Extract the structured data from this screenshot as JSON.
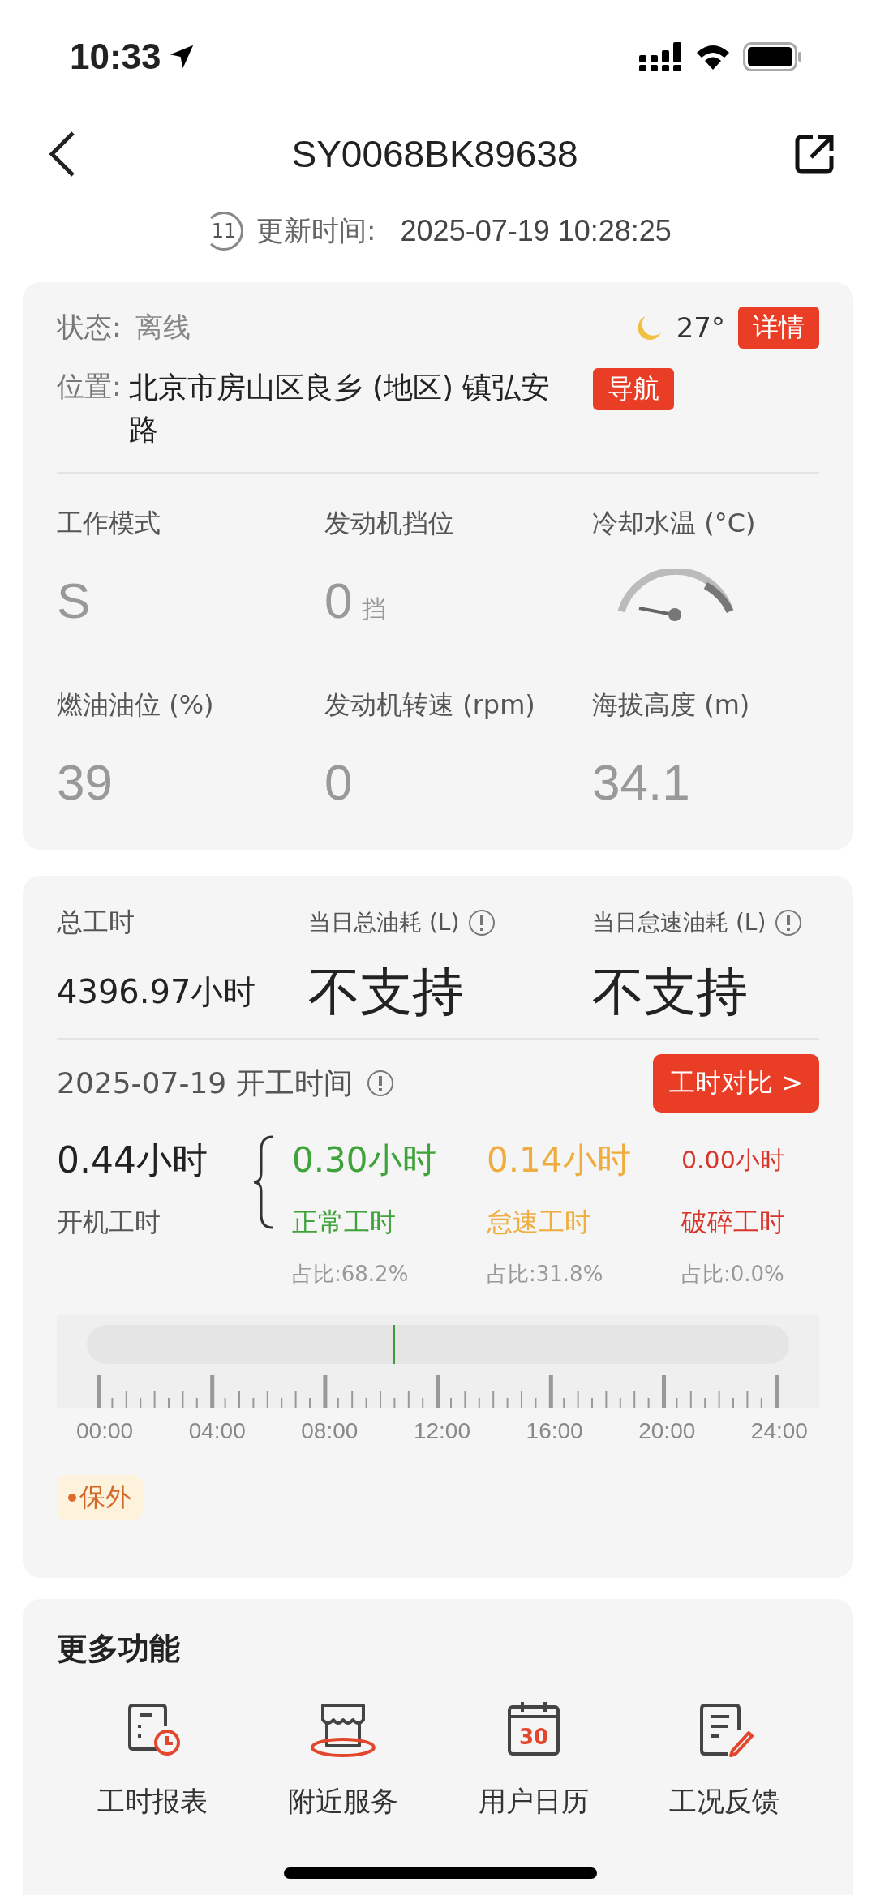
{
  "status_bar": {
    "time": "10:33"
  },
  "nav": {
    "title": "SY0068BK89638"
  },
  "update": {
    "countdown": "11",
    "label": "更新时间:",
    "time": "2025-07-19 10:28:25"
  },
  "overview": {
    "status_label": "状态:",
    "status": "离线",
    "temperature": "27°",
    "detail_button": "详情",
    "location_label": "位置:",
    "location": "北京市房山区良乡 (地区) 镇弘安路",
    "nav_button": "导航",
    "metrics": [
      {
        "kind": "text",
        "label": "工作模式",
        "value": "S"
      },
      {
        "kind": "text",
        "label": "发动机挡位",
        "value": "0",
        "unit": "挡"
      },
      {
        "kind": "gauge",
        "label": "冷却水温 (°C)"
      },
      {
        "kind": "text",
        "label": "燃油油位 (%)",
        "value": "39"
      },
      {
        "kind": "text",
        "label": "发动机转速 (rpm)",
        "value": "0"
      },
      {
        "kind": "text",
        "label": "海拔高度 (m)",
        "value": "34.1"
      }
    ]
  },
  "work": {
    "stats": [
      {
        "kind": "number",
        "label": "总工时",
        "value": "4396.97小时",
        "info": false
      },
      {
        "kind": "unsupported",
        "label": "当日总油耗 (L)",
        "value": "不支持",
        "info": true
      },
      {
        "kind": "unsupported",
        "label": "当日怠速油耗 (L)",
        "value": "不支持",
        "info": true
      }
    ],
    "date_title": "2025-07-19 开工时间",
    "compare_button": "工时对比 >",
    "total": {
      "value": "0.44小时",
      "label": "开机工时"
    },
    "breakdown": [
      {
        "kind": "large",
        "value": "0.30小时",
        "label": "正常工时",
        "share": "占比:68.2%",
        "color": "#3fa33b"
      },
      {
        "kind": "large",
        "value": "0.14小时",
        "label": "怠速工时",
        "share": "占比:31.8%",
        "color": "#efad3f"
      },
      {
        "kind": "small",
        "value": "0.00小时",
        "label": "破碎工时",
        "share": "占比:0.0%",
        "color": "#d8352b"
      }
    ],
    "timeline": {
      "level": 0.437,
      "ticks": [
        "00:00",
        "04:00",
        "08:00",
        "12:00",
        "16:00",
        "20:00",
        "24:00"
      ]
    },
    "tag": "保外"
  },
  "more": {
    "title": "更多功能",
    "items": [
      {
        "kind": "report",
        "label": "工时报表"
      },
      {
        "kind": "store",
        "label": "附近服务"
      },
      {
        "kind": "calendar",
        "label": "用户日历",
        "icon_text": "30"
      },
      {
        "kind": "feedback",
        "label": "工况反馈"
      }
    ]
  }
}
